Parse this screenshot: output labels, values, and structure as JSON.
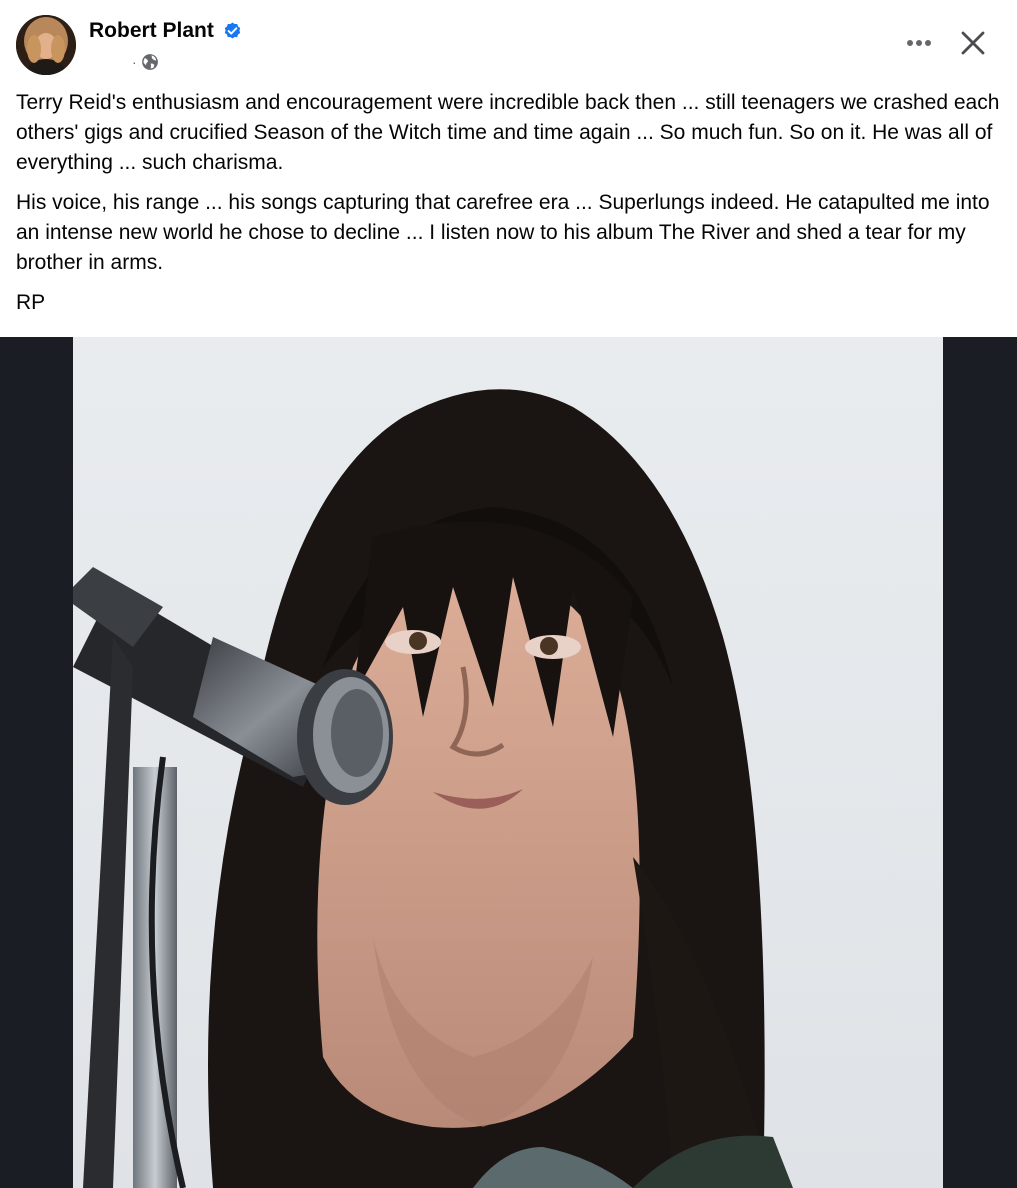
{
  "post": {
    "author": "Robert Plant",
    "meta_separator": "·",
    "icons": {
      "verified": "verified-badge-icon",
      "audience": "globe-icon",
      "more": "more-horizontal-icon",
      "close": "close-icon"
    },
    "colors": {
      "verified": "#1877f2",
      "text": "#050505",
      "secondary": "#65676b",
      "photo_backdrop": "#1b1d24"
    },
    "paragraphs": [
      "Terry Reid's enthusiasm and encouragement were incredible back then ... still teenagers we crashed each others' gigs and crucified Season of the Witch time and time again ... So much fun. So on it. He was all of everything ... such charisma.",
      "His voice, his range ... his songs capturing that carefree era ... Superlungs indeed. He catapulted me into an intense new world he chose to decline ... I listen now to his album The River and shed a tear for my brother in arms.",
      "RP"
    ]
  }
}
